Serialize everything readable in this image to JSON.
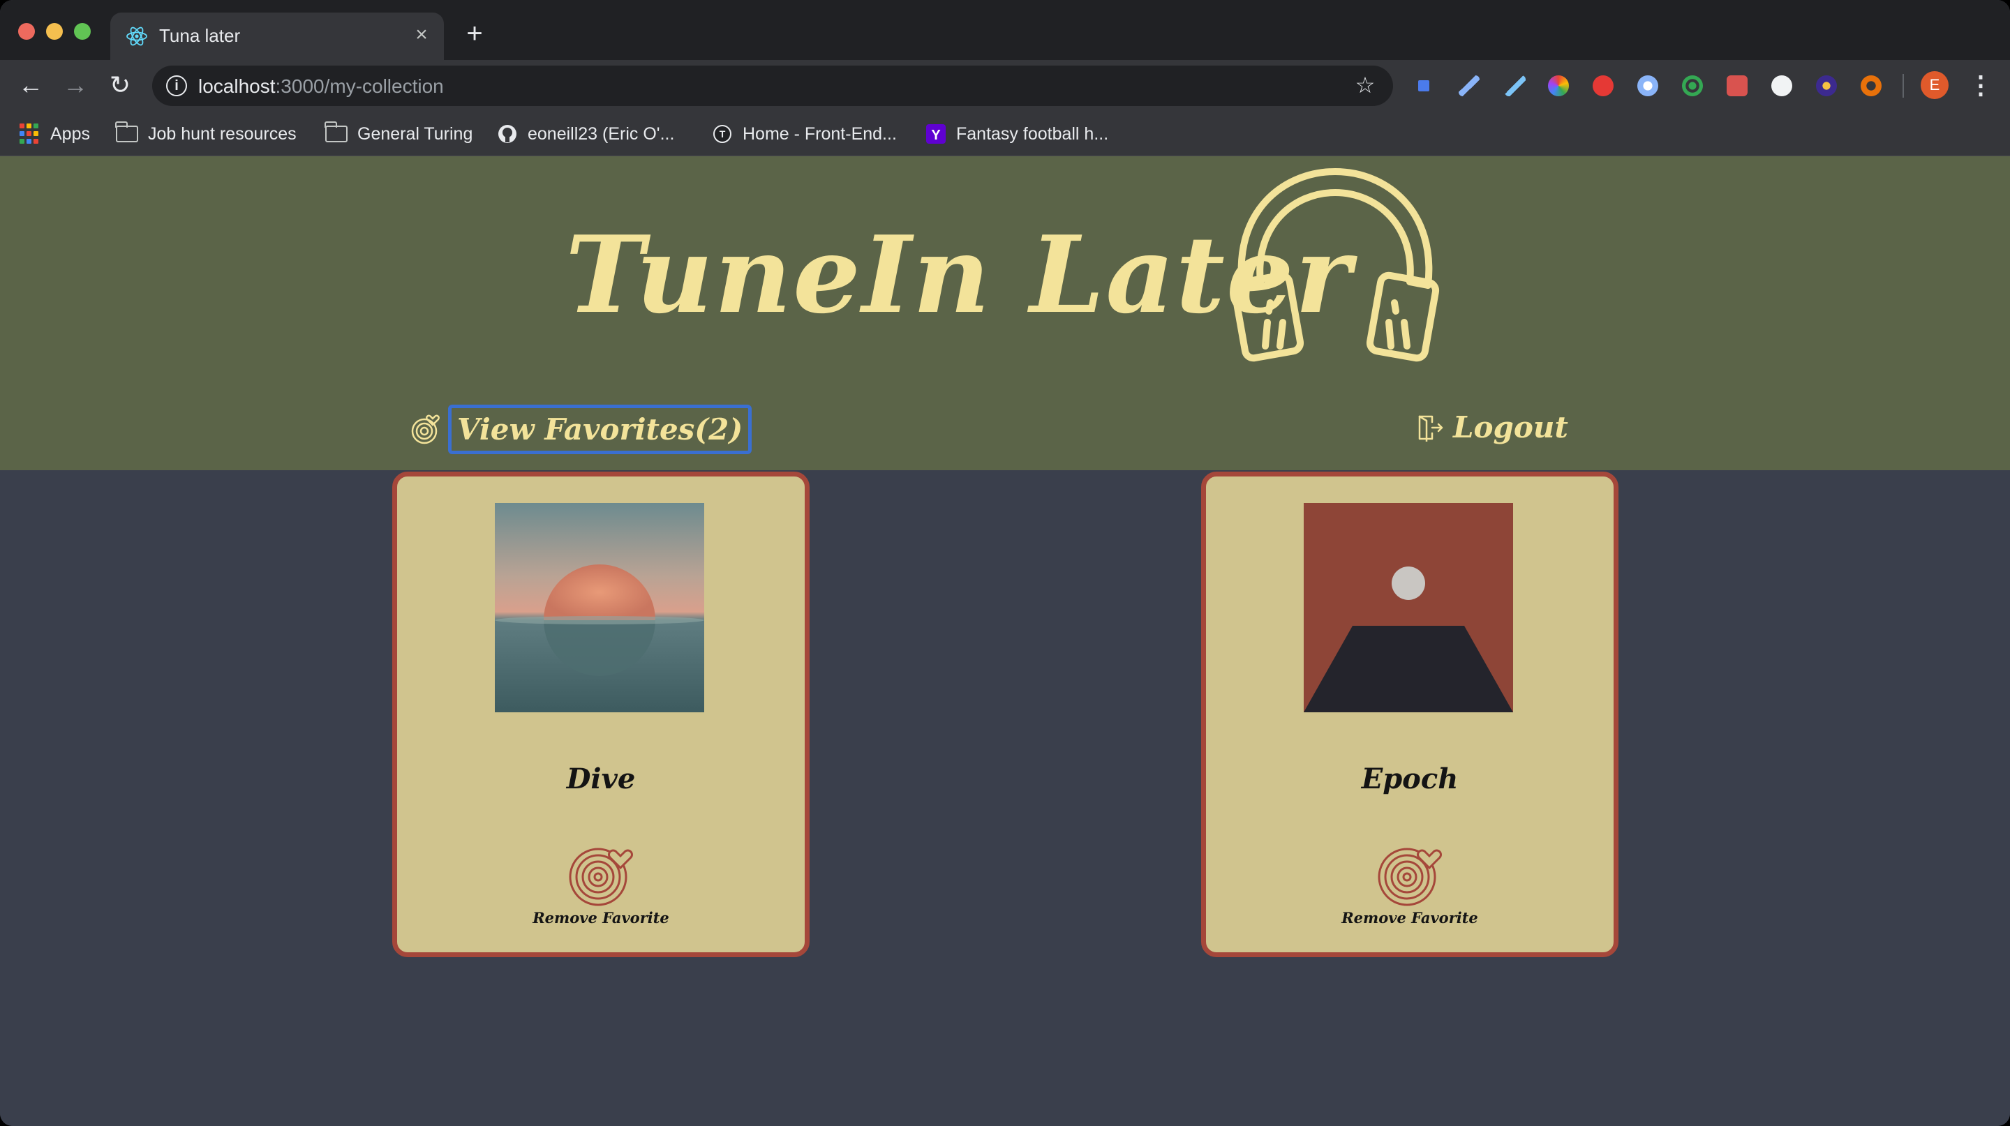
{
  "browser": {
    "tab": {
      "title": "Tuna later",
      "favicon": "react-icon"
    },
    "url": {
      "host": "localhost",
      "path": ":3000/my-collection"
    },
    "profile_initial": "E",
    "bookmarks": [
      {
        "label": "Apps",
        "icon": "apps-grid-icon"
      },
      {
        "label": "Job hunt resources",
        "icon": "folder-icon"
      },
      {
        "label": "General Turing",
        "icon": "folder-icon"
      },
      {
        "label": "eoneill23 (Eric O'...",
        "icon": "github-icon"
      },
      {
        "label": "Home - Front-End...",
        "icon": "turing-icon"
      },
      {
        "label": "Fantasy football h...",
        "icon": "yahoo-icon"
      }
    ]
  },
  "app": {
    "title": "TuneIn Later",
    "nav": {
      "favorites_label": "View Favorites(2)",
      "logout_label": "Logout"
    },
    "colors": {
      "header_bg": "#5b6448",
      "page_bg": "#3a3f4c",
      "accent_text": "#f3e39a",
      "card_bg": "#d0c48e",
      "card_border": "#a5473a"
    },
    "favorites": [
      {
        "title": "Dive",
        "action_label": "Remove Favorite"
      },
      {
        "title": "Epoch",
        "action_label": "Remove Favorite"
      }
    ]
  }
}
